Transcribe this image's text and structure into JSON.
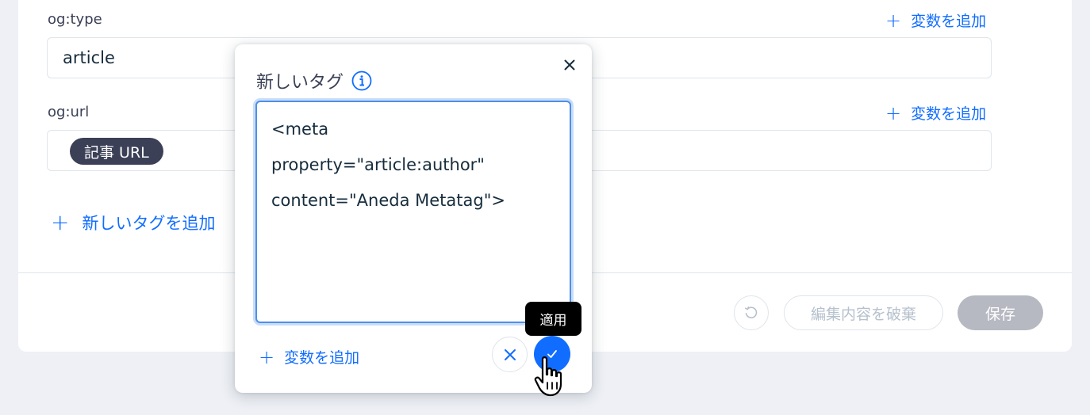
{
  "fields": [
    {
      "label": "og:type",
      "value": "article",
      "add_variable": "変数を追加"
    },
    {
      "label": "og:url",
      "chip": "記事 URL",
      "add_variable": "変数を追加"
    }
  ],
  "add_new_tag": "新しいタグを追加",
  "footer": {
    "discard_label": "編集内容を破棄",
    "save_label": "保存"
  },
  "popup": {
    "title": "新しいタグ",
    "code_lines": [
      "<meta",
      "property=\"article:author\"",
      "content=\"Aneda Metatag\">"
    ],
    "add_variable": "変数を追加",
    "tooltip": "適用"
  },
  "icons": {
    "plus": "plus-icon",
    "info": "info-icon",
    "close": "close-icon",
    "reset": "reset-icon",
    "check": "check-icon",
    "cursor": "hand-pointer-icon"
  },
  "colors": {
    "accent": "#116dff",
    "text_dark": "#162d3d",
    "chip_bg": "#3b4057",
    "save_disabled": "#b6b9c2",
    "background": "#eef0f5"
  }
}
